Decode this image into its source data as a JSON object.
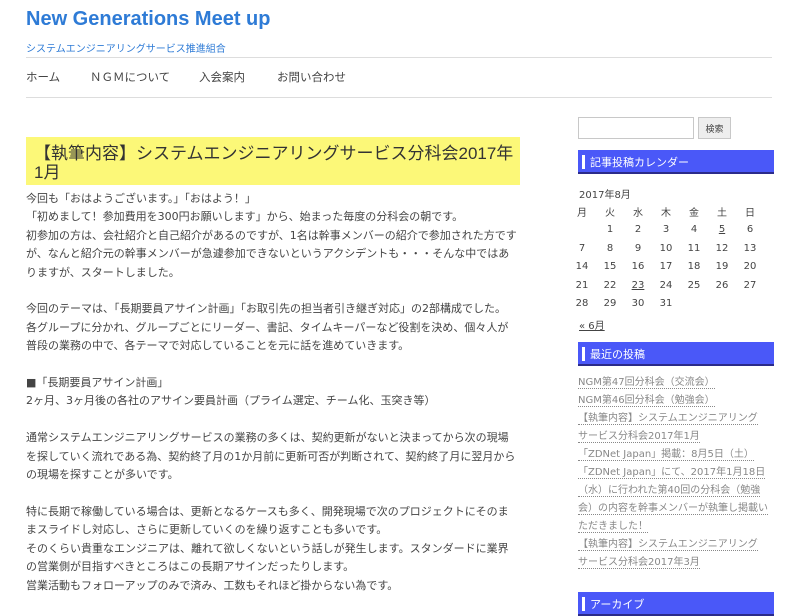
{
  "site": {
    "title": "New Generations Meet up",
    "description": "システムエンジニアリングサービス推進組合"
  },
  "nav": [
    {
      "label": "ホーム"
    },
    {
      "label": "ＮＧＭについて"
    },
    {
      "label": "入会案内"
    },
    {
      "label": "お問い合わせ"
    }
  ],
  "post": {
    "title": "【執筆内容】システムエンジニアリングサービス分科会2017年1月",
    "paragraphs": [
      "今回も「おはようございます。」「おはよう！」",
      "「初めまして！参加費用を300円お願いします」から、始まった毎度の分科会の朝です。",
      "初参加の方は、会社紹介と自己紹介があるのですが、1名は幹事メンバーの紹介で参加された方です",
      "が、なんと紹介元の幹事メンバーが急遽参加できないというアクシデントも・・・そんな中ではあ",
      "りますが、スタートしました。",
      "",
      "今回のテーマは、「長期要員アサイン計画」「お取引先の担当者引き継ぎ対応」の2部構成でした。",
      "各グループに分かれ、グループごとにリーダー、書記、タイムキーパーなど役割を決め、個々人が",
      "普段の業務の中で、各テーマで対応していることを元に話を進めていきます。",
      "",
      "■「長期要員アサイン計画」",
      "2ヶ月、3ヶ月後の各社のアサイン要員計画（プライム選定、チーム化、玉突き等）",
      "",
      "通常システムエンジニアリングサービスの業務の多くは、契約更新がないと決まってから次の現場",
      "を探していく流れである為、契約終了月の1か月前に更新可否が判断されて、契約終了月に翌月から",
      "の現場を探すことが多いです。",
      "",
      "特に長期で稼働している場合は、更新となるケースも多く、開発現場で次のプロジェクトにそのま",
      "まスライドし対応し、さらに更新していくのを繰り返すことも多いです。",
      "そのくらい貴重なエンジニアは、離れて欲しくないという話しが発生します。スタンダードに業界",
      "の営業側が目指すべきところはこの長期アサインだったりします。",
      "営業活動もフォローアップのみで済み、工数もそれほど掛からない為です。"
    ]
  },
  "sidebar": {
    "search": {
      "value": "",
      "placeholder": "",
      "button_label": "検索"
    },
    "calendar": {
      "heading": "記事投稿カレンダー",
      "caption": "2017年8月",
      "weekdays": [
        "月",
        "火",
        "水",
        "木",
        "金",
        "土",
        "日"
      ],
      "weeks": [
        [
          "",
          "1",
          "2",
          "3",
          "4",
          "5",
          "6"
        ],
        [
          "7",
          "8",
          "9",
          "10",
          "11",
          "12",
          "13"
        ],
        [
          "14",
          "15",
          "16",
          "17",
          "18",
          "19",
          "20"
        ],
        [
          "21",
          "22",
          "23",
          "24",
          "25",
          "26",
          "27"
        ],
        [
          "28",
          "29",
          "30",
          "31",
          "",
          "",
          ""
        ]
      ],
      "linked_days": [
        "5",
        "23"
      ],
      "prev_label": "« 6月"
    },
    "recent": {
      "heading": "最近の投稿",
      "lines": [
        [
          "NGM第47回分科会（交流会）"
        ],
        [
          "NGM第46回分科会（勉強会）"
        ],
        [
          "【執筆内容】システムエンジニアリング",
          "サービス分科会2017年1月"
        ],
        [
          "「ZDNet Japan」掲載：8月5日（土）"
        ],
        [
          "「ZDNet Japan」にて、2017年1月18日",
          "（水）に行われた第40回の分科会（勉強",
          "会）の内容を幹事メンバーが執筆し掲載い",
          "ただきました！"
        ],
        [
          "【執筆内容】システムエンジニアリング",
          "サービス分科会2017年3月"
        ]
      ]
    },
    "archive": {
      "heading": "アーカイブ"
    }
  },
  "colors": {
    "accent": "#2e7bd6",
    "widget_header": "#4a58f8",
    "post_title_bg": "#fcf878"
  }
}
